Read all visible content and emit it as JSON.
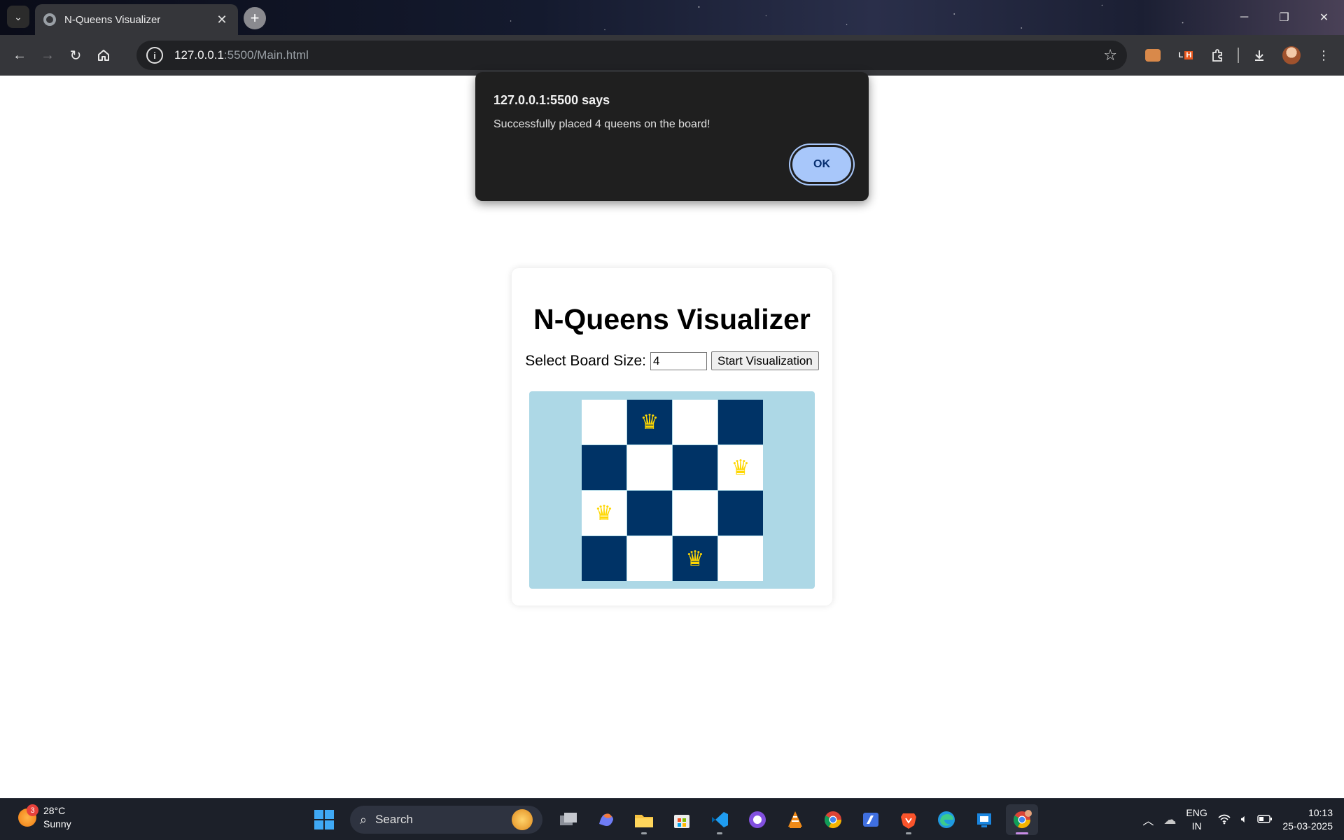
{
  "browser": {
    "tab_title": "N-Queens Visualizer",
    "tab_close": "✕",
    "new_tab": "+",
    "url_host": "127.0.0.1",
    "url_path": ":5500/Main.html",
    "ext_lh_label": "L",
    "ext_lh_badge": "H"
  },
  "dialog": {
    "title": "127.0.0.1:5500 says",
    "message": "Successfully placed 4 queens on the board!",
    "ok_label": "OK"
  },
  "app": {
    "title": "N-Queens Visualizer",
    "size_label": "Select Board Size:",
    "size_value": "4",
    "start_label": "Start Visualization",
    "queen_glyph": "♛",
    "board": {
      "size": 4,
      "queens": [
        [
          0,
          1
        ],
        [
          1,
          3
        ],
        [
          2,
          0
        ],
        [
          3,
          2
        ]
      ],
      "light_color": "#ffffff",
      "dark_color": "#003366",
      "queen_color": "#ffd700",
      "background": "#add8e6"
    }
  },
  "taskbar": {
    "weather_badge": "3",
    "temperature": "28°C",
    "condition": "Sunny",
    "search_label": "Search",
    "language_top": "ENG",
    "language_bottom": "IN",
    "time": "10:13",
    "date": "25-03-2025",
    "apps": [
      "file-manager-icon",
      "copilot-icon",
      "file-explorer-icon",
      "microsoft-store-icon",
      "vscode-icon",
      "github-desktop-icon",
      "vlc-icon",
      "chrome-icon",
      "notepad-icon",
      "brave-icon",
      "edge-icon",
      "app-icon",
      "chrome-active-icon"
    ]
  }
}
